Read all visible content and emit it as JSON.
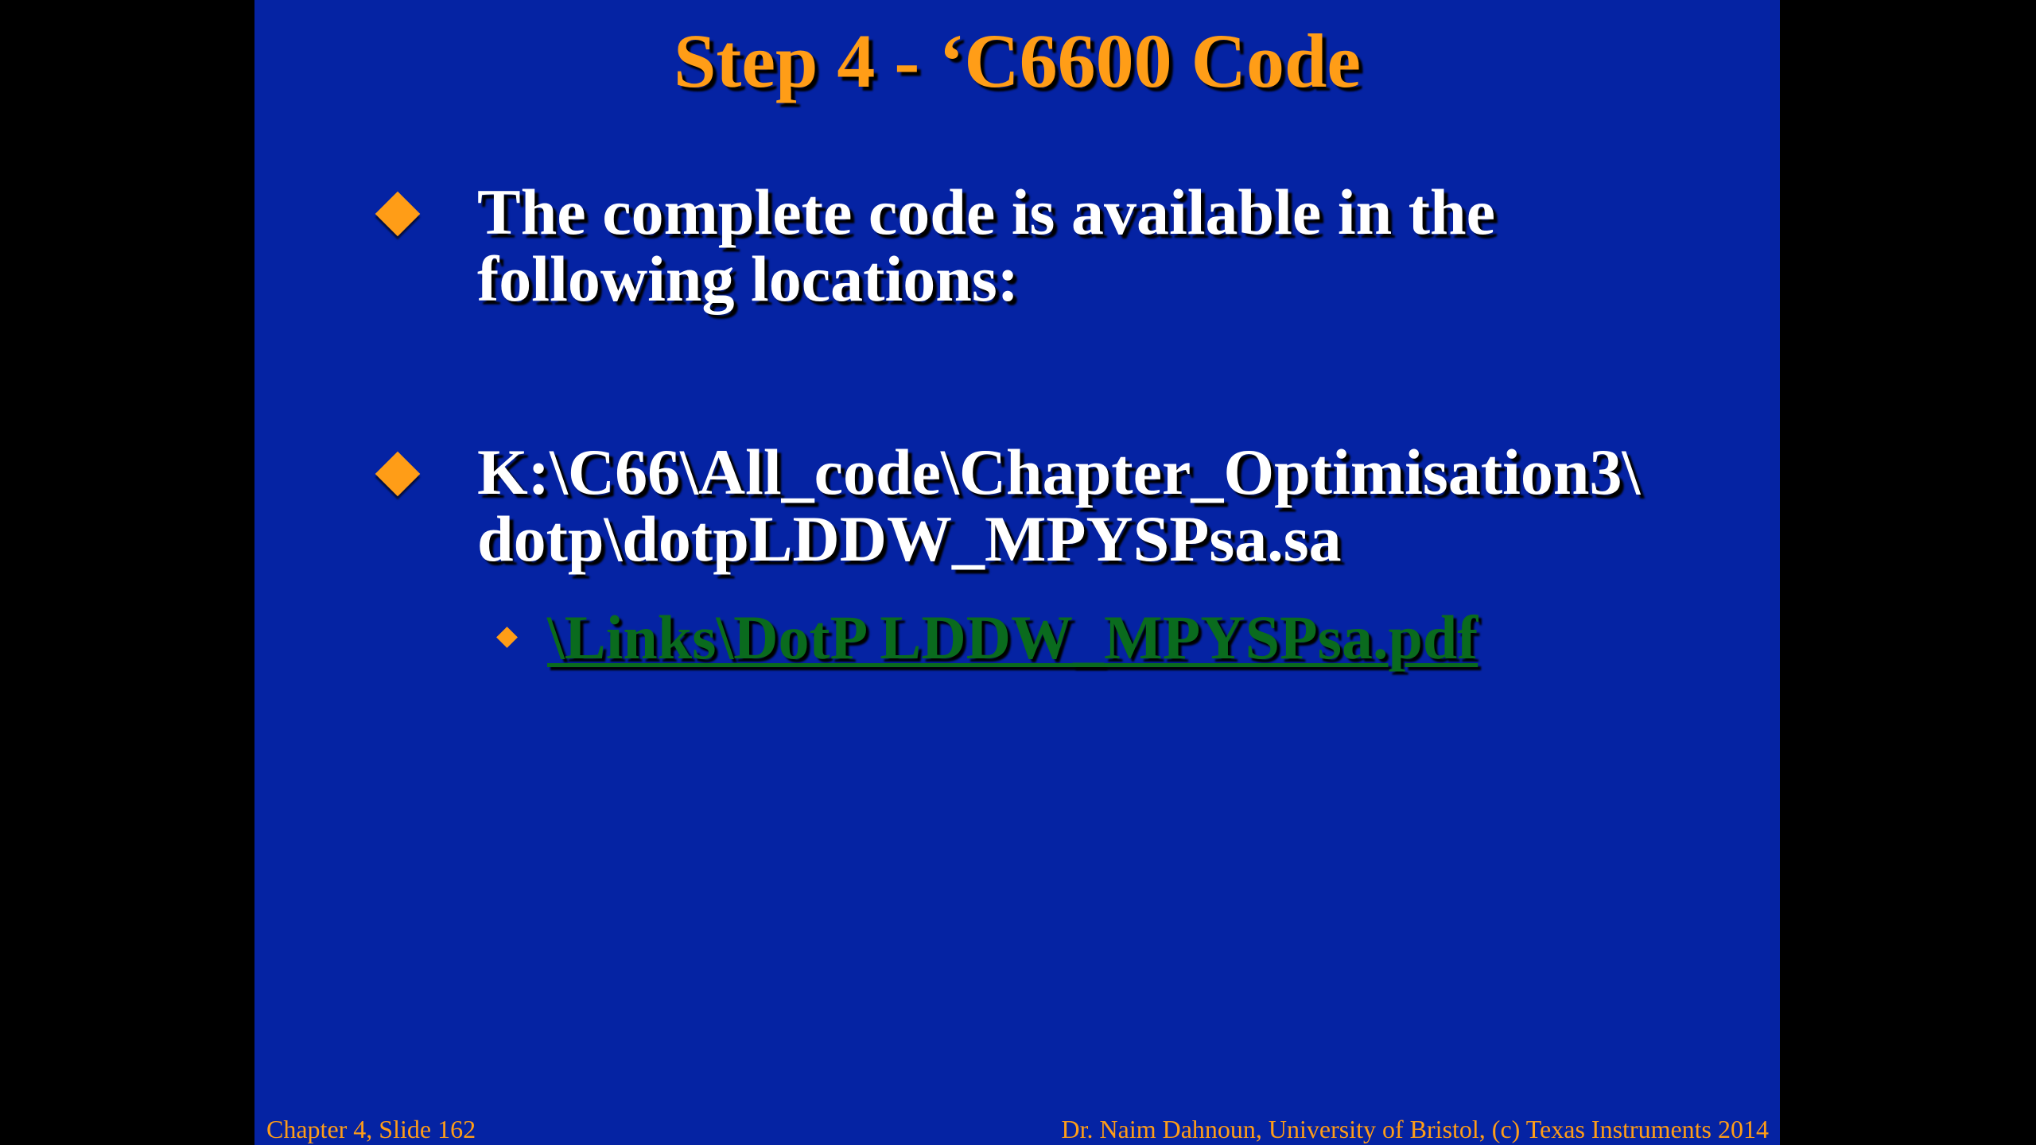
{
  "slide": {
    "title": "Step 4 - ‘C6600 Code",
    "bullets": [
      {
        "lines": [
          "The complete code is available in the",
          "following locations:"
        ]
      },
      {
        "lines": [
          "K:\\C66\\All_code\\Chapter_Optimisation3\\",
          "dotp\\dotpLDDW_MPYSPsa.sa"
        ]
      }
    ],
    "sub_link": "\\Links\\DotP LDDW_MPYSPsa.pdf",
    "footer_left": "Chapter 4, Slide 162",
    "footer_right": "Dr. Naim Dahnoun, University of Bristol,  (c) Texas Instruments 2014"
  },
  "colors": {
    "slide_background": "#0523a3",
    "title": "#ff9d17",
    "bullet_marker": "#ff9d17",
    "body_text": "#ffffff",
    "link": "#0a6b1e",
    "footer": "#ff9d17",
    "viewer_background": "#000000"
  }
}
